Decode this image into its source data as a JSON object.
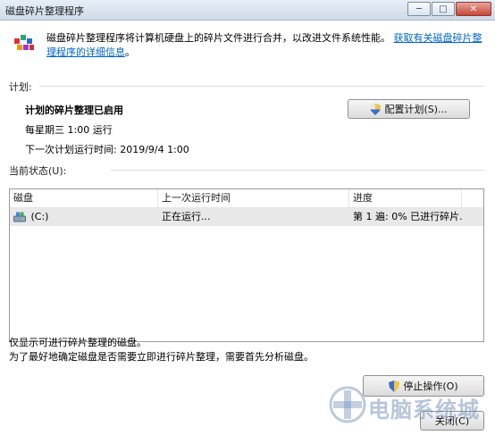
{
  "window": {
    "title": "磁盘碎片整理程序",
    "controls": {
      "minimize": "─",
      "maximize": "□",
      "close": "✕"
    }
  },
  "description": {
    "text": "磁盘碎片整理程序将计算机硬盘上的碎片文件进行合并，以改进文件系统性能。",
    "link_line1": "获取有关磁盘碎片整理程",
    "link_line2": "序的详细信息",
    "link_suffix": "。"
  },
  "schedule": {
    "section_label": "计划:",
    "status": "计划的碎片整理已启用",
    "frequency": "每星期三  1:00 运行",
    "next_run": "下一次计划运行时间: 2019/9/4 1:00",
    "configure_button": "配置计划(S)..."
  },
  "current_status": {
    "section_label": "当前状态(U):",
    "columns": [
      "磁盘",
      "上一次运行时间",
      "进度"
    ],
    "rows": [
      {
        "disk": "(C:)",
        "last_run": "正在运行...",
        "progress": "第 1 遍: 0% 已进行碎片..."
      }
    ]
  },
  "notes": {
    "line1": "仅显示可进行碎片整理的磁盘。",
    "line2": "为了最好地确定磁盘是否需要立即进行碎片整理，需要首先分析磁盘。"
  },
  "actions": {
    "stop_button": "停止操作(O)",
    "close_button": "关闭(C)"
  },
  "watermark": "电脑系统城",
  "icons": {
    "app": "defrag-app-icon",
    "shield": "uac-shield-icon",
    "drive": "hard-drive-icon"
  }
}
